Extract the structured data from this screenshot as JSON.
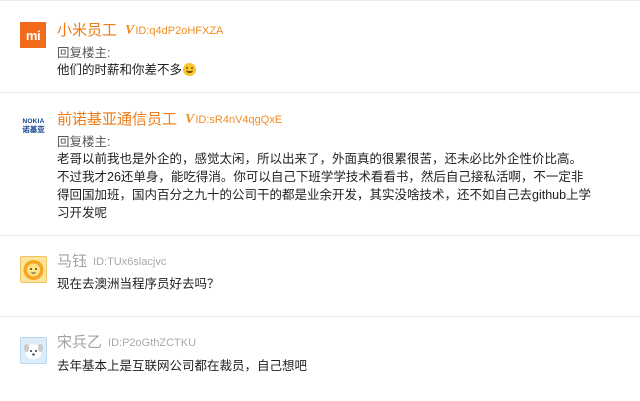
{
  "comments": [
    {
      "username": "小米员工",
      "vip": "V",
      "id": "ID:q4dP2oHFXZA",
      "avatar_text": "mi",
      "reply_label": "回复楼主:",
      "body": [
        "他们的时薪和你差不多"
      ]
    },
    {
      "username": "前诺基亚通信员工",
      "vip": "V",
      "id": "ID:sR4nV4qgQxE",
      "avatar_text_top": "NOKIA",
      "avatar_text_bottom": "诺基亚",
      "reply_label": "回复楼主:",
      "body": [
        "老哥以前我也是外企的，感觉太闲，所以出来了，外面真的很累很苦，还未必比外企性价比高。",
        "不过我才26还单身，能吃得消。你可以自己下班学学技术看看书，然后自己接私活啊，不一定非",
        "得回国加班，国内百分之九十的公司干的都是业余开发，其实没啥技术，还不如自己去github上学",
        "习开发呢"
      ]
    },
    {
      "username": "马钰",
      "id": "ID:TUx6slacjvc",
      "body": [
        "现在去澳洲当程序员好去吗？"
      ]
    },
    {
      "username": "宋兵乙",
      "id": "ID:P2oGthZCTKU",
      "body": [
        "去年基本上是互联网公司都在裁员，自己想吧"
      ]
    }
  ],
  "colors": {
    "vip_orange": "#ee7b15",
    "gray_name": "#a2a2a2",
    "xiaomi_orange": "#f26a1b",
    "nokia_blue": "#124191"
  }
}
